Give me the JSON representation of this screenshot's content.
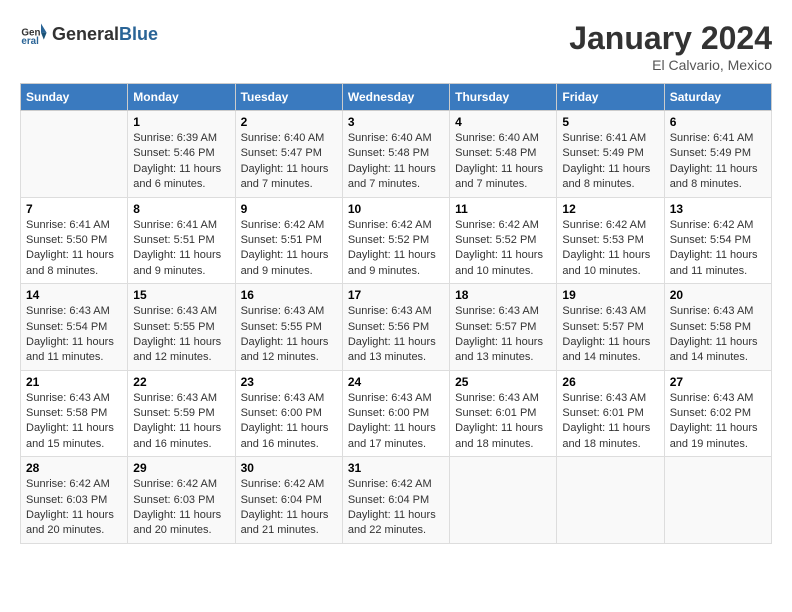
{
  "header": {
    "logo_general": "General",
    "logo_blue": "Blue",
    "main_title": "January 2024",
    "subtitle": "El Calvario, Mexico"
  },
  "calendar": {
    "weekdays": [
      "Sunday",
      "Monday",
      "Tuesday",
      "Wednesday",
      "Thursday",
      "Friday",
      "Saturday"
    ],
    "weeks": [
      [
        {
          "day": "",
          "sunrise": "",
          "sunset": "",
          "daylight": ""
        },
        {
          "day": "1",
          "sunrise": "Sunrise: 6:39 AM",
          "sunset": "Sunset: 5:46 PM",
          "daylight": "Daylight: 11 hours and 6 minutes."
        },
        {
          "day": "2",
          "sunrise": "Sunrise: 6:40 AM",
          "sunset": "Sunset: 5:47 PM",
          "daylight": "Daylight: 11 hours and 7 minutes."
        },
        {
          "day": "3",
          "sunrise": "Sunrise: 6:40 AM",
          "sunset": "Sunset: 5:48 PM",
          "daylight": "Daylight: 11 hours and 7 minutes."
        },
        {
          "day": "4",
          "sunrise": "Sunrise: 6:40 AM",
          "sunset": "Sunset: 5:48 PM",
          "daylight": "Daylight: 11 hours and 7 minutes."
        },
        {
          "day": "5",
          "sunrise": "Sunrise: 6:41 AM",
          "sunset": "Sunset: 5:49 PM",
          "daylight": "Daylight: 11 hours and 8 minutes."
        },
        {
          "day": "6",
          "sunrise": "Sunrise: 6:41 AM",
          "sunset": "Sunset: 5:49 PM",
          "daylight": "Daylight: 11 hours and 8 minutes."
        }
      ],
      [
        {
          "day": "7",
          "sunrise": "Sunrise: 6:41 AM",
          "sunset": "Sunset: 5:50 PM",
          "daylight": "Daylight: 11 hours and 8 minutes."
        },
        {
          "day": "8",
          "sunrise": "Sunrise: 6:41 AM",
          "sunset": "Sunset: 5:51 PM",
          "daylight": "Daylight: 11 hours and 9 minutes."
        },
        {
          "day": "9",
          "sunrise": "Sunrise: 6:42 AM",
          "sunset": "Sunset: 5:51 PM",
          "daylight": "Daylight: 11 hours and 9 minutes."
        },
        {
          "day": "10",
          "sunrise": "Sunrise: 6:42 AM",
          "sunset": "Sunset: 5:52 PM",
          "daylight": "Daylight: 11 hours and 9 minutes."
        },
        {
          "day": "11",
          "sunrise": "Sunrise: 6:42 AM",
          "sunset": "Sunset: 5:52 PM",
          "daylight": "Daylight: 11 hours and 10 minutes."
        },
        {
          "day": "12",
          "sunrise": "Sunrise: 6:42 AM",
          "sunset": "Sunset: 5:53 PM",
          "daylight": "Daylight: 11 hours and 10 minutes."
        },
        {
          "day": "13",
          "sunrise": "Sunrise: 6:42 AM",
          "sunset": "Sunset: 5:54 PM",
          "daylight": "Daylight: 11 hours and 11 minutes."
        }
      ],
      [
        {
          "day": "14",
          "sunrise": "Sunrise: 6:43 AM",
          "sunset": "Sunset: 5:54 PM",
          "daylight": "Daylight: 11 hours and 11 minutes."
        },
        {
          "day": "15",
          "sunrise": "Sunrise: 6:43 AM",
          "sunset": "Sunset: 5:55 PM",
          "daylight": "Daylight: 11 hours and 12 minutes."
        },
        {
          "day": "16",
          "sunrise": "Sunrise: 6:43 AM",
          "sunset": "Sunset: 5:55 PM",
          "daylight": "Daylight: 11 hours and 12 minutes."
        },
        {
          "day": "17",
          "sunrise": "Sunrise: 6:43 AM",
          "sunset": "Sunset: 5:56 PM",
          "daylight": "Daylight: 11 hours and 13 minutes."
        },
        {
          "day": "18",
          "sunrise": "Sunrise: 6:43 AM",
          "sunset": "Sunset: 5:57 PM",
          "daylight": "Daylight: 11 hours and 13 minutes."
        },
        {
          "day": "19",
          "sunrise": "Sunrise: 6:43 AM",
          "sunset": "Sunset: 5:57 PM",
          "daylight": "Daylight: 11 hours and 14 minutes."
        },
        {
          "day": "20",
          "sunrise": "Sunrise: 6:43 AM",
          "sunset": "Sunset: 5:58 PM",
          "daylight": "Daylight: 11 hours and 14 minutes."
        }
      ],
      [
        {
          "day": "21",
          "sunrise": "Sunrise: 6:43 AM",
          "sunset": "Sunset: 5:58 PM",
          "daylight": "Daylight: 11 hours and 15 minutes."
        },
        {
          "day": "22",
          "sunrise": "Sunrise: 6:43 AM",
          "sunset": "Sunset: 5:59 PM",
          "daylight": "Daylight: 11 hours and 16 minutes."
        },
        {
          "day": "23",
          "sunrise": "Sunrise: 6:43 AM",
          "sunset": "Sunset: 6:00 PM",
          "daylight": "Daylight: 11 hours and 16 minutes."
        },
        {
          "day": "24",
          "sunrise": "Sunrise: 6:43 AM",
          "sunset": "Sunset: 6:00 PM",
          "daylight": "Daylight: 11 hours and 17 minutes."
        },
        {
          "day": "25",
          "sunrise": "Sunrise: 6:43 AM",
          "sunset": "Sunset: 6:01 PM",
          "daylight": "Daylight: 11 hours and 18 minutes."
        },
        {
          "day": "26",
          "sunrise": "Sunrise: 6:43 AM",
          "sunset": "Sunset: 6:01 PM",
          "daylight": "Daylight: 11 hours and 18 minutes."
        },
        {
          "day": "27",
          "sunrise": "Sunrise: 6:43 AM",
          "sunset": "Sunset: 6:02 PM",
          "daylight": "Daylight: 11 hours and 19 minutes."
        }
      ],
      [
        {
          "day": "28",
          "sunrise": "Sunrise: 6:42 AM",
          "sunset": "Sunset: 6:03 PM",
          "daylight": "Daylight: 11 hours and 20 minutes."
        },
        {
          "day": "29",
          "sunrise": "Sunrise: 6:42 AM",
          "sunset": "Sunset: 6:03 PM",
          "daylight": "Daylight: 11 hours and 20 minutes."
        },
        {
          "day": "30",
          "sunrise": "Sunrise: 6:42 AM",
          "sunset": "Sunset: 6:04 PM",
          "daylight": "Daylight: 11 hours and 21 minutes."
        },
        {
          "day": "31",
          "sunrise": "Sunrise: 6:42 AM",
          "sunset": "Sunset: 6:04 PM",
          "daylight": "Daylight: 11 hours and 22 minutes."
        },
        {
          "day": "",
          "sunrise": "",
          "sunset": "",
          "daylight": ""
        },
        {
          "day": "",
          "sunrise": "",
          "sunset": "",
          "daylight": ""
        },
        {
          "day": "",
          "sunrise": "",
          "sunset": "",
          "daylight": ""
        }
      ]
    ]
  }
}
